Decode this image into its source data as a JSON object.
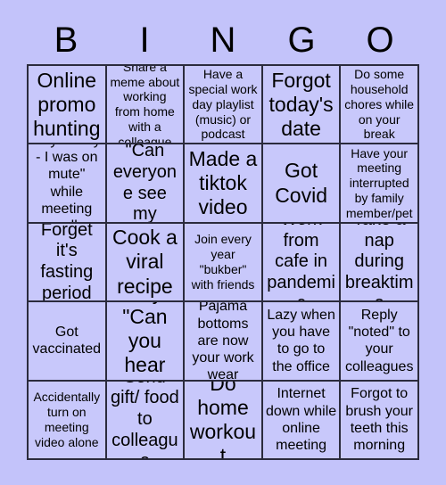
{
  "colors": {
    "page_background": "#c3c3fa",
    "cell_background": "#c8c8fb",
    "grid_line": "#2b2b3d",
    "text": "#000000"
  },
  "header": {
    "letters": [
      "B",
      "I",
      "N",
      "G",
      "O"
    ]
  },
  "grid": {
    "columns": 5,
    "rows": 5,
    "cells": [
      {
        "text": "Online promo hunting",
        "size": "fs-xl"
      },
      {
        "text": "Share a meme about working from home with a colleague",
        "size": "fs-sm"
      },
      {
        "text": "Have a special work day playlist (music) or podcast",
        "size": "fs-sm"
      },
      {
        "text": "Forgot today's date",
        "size": "fs-xl"
      },
      {
        "text": "Do some household chores while on your break",
        "size": "fs-sm"
      },
      {
        "text": "Say \"Sorry - I was on mute\" while meeting call",
        "size": "fs-md"
      },
      {
        "text": "Ask \"Can everyone see my screen?\"",
        "size": "fs-lg"
      },
      {
        "text": "Made a tiktok video",
        "size": "fs-xl"
      },
      {
        "text": "Got Covid",
        "size": "fs-xl"
      },
      {
        "text": "Have your meeting interrupted by family member/pet",
        "size": "fs-sm"
      },
      {
        "text": "Forget it's fasting period",
        "size": "fs-lg"
      },
      {
        "text": "Cook a viral recipe",
        "size": "fs-xl"
      },
      {
        "text": "Join every year \"bukber\" with friends",
        "size": "fs-sm"
      },
      {
        "text": "Work from cafe in pandemic",
        "size": "fs-lg"
      },
      {
        "text": "Take a nap during breaktime",
        "size": "fs-lg"
      },
      {
        "text": "Got vaccinated",
        "size": "fs-md"
      },
      {
        "text": "Say \"Can you hear me?\"",
        "size": "fs-xl"
      },
      {
        "text": "Pajama bottoms are now your work wear",
        "size": "fs-md"
      },
      {
        "text": "Lazy when you have to go to the office",
        "size": "fs-md"
      },
      {
        "text": "Reply \"noted\" to your colleagues",
        "size": "fs-md"
      },
      {
        "text": "Accidentally turn on meeting video alone",
        "size": "fs-sm"
      },
      {
        "text": "Send gift/ food to colleague",
        "size": "fs-lg"
      },
      {
        "text": "Do home workout",
        "size": "fs-xl"
      },
      {
        "text": "Internet down while online meeting",
        "size": "fs-md"
      },
      {
        "text": "Forgot to brush your teeth this morning",
        "size": "fs-md"
      }
    ]
  }
}
